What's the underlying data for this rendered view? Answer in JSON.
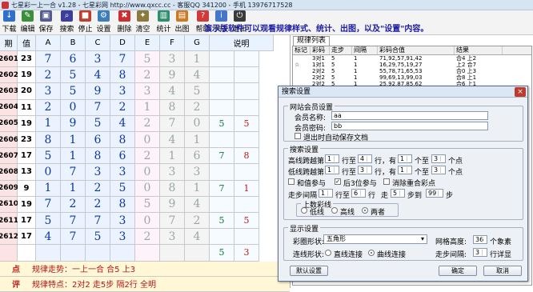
{
  "window": {
    "title": "七星彩一上一合 v1.28 - 七星彩网 http://www.qxcc.cc - 客服QQ 341200 - 手机 13976717528"
  },
  "toolbar": {
    "buttons": [
      {
        "label": "下载",
        "icon": "download-icon",
        "color": "#2e6fcf"
      },
      {
        "label": "编辑",
        "icon": "edit-icon",
        "color": "#3b8f3b"
      },
      {
        "label": "保存",
        "icon": "save-icon",
        "color": "#555b8f"
      },
      {
        "label": "搜索",
        "icon": "search-icon",
        "color": "#3d3d9b"
      },
      {
        "label": "停止",
        "icon": "stop-icon",
        "color": "#c23d2a"
      },
      {
        "label": "设置",
        "icon": "settings-icon",
        "color": "#3c7dbc"
      },
      {
        "label": "删除",
        "icon": "delete-icon",
        "color": "#cc2f2f"
      },
      {
        "label": "清空",
        "icon": "clear-icon",
        "color": "#8c7a3c"
      },
      {
        "label": "统计",
        "icon": "stats-icon",
        "color": "#2e8c6f"
      },
      {
        "label": "出图",
        "icon": "chart-icon",
        "color": "#cc7a22"
      },
      {
        "label": "帮助",
        "icon": "help-icon",
        "color": "#d23a3a"
      },
      {
        "label": "关于",
        "icon": "about-icon",
        "color": "#4477cc"
      },
      {
        "label": "退出",
        "icon": "exit-icon",
        "color": "#3a3a3a"
      }
    ],
    "promo": "演示版软件可以观看规律样式、统计、出图，以及\"设置\"内容。"
  },
  "grid": {
    "headers": [
      "期",
      "值",
      "A",
      "B",
      "C",
      "D",
      "E",
      "F",
      "G",
      "说明"
    ],
    "rows": [
      {
        "period": "2601",
        "value": "23",
        "digits": [
          "7",
          "6",
          "3",
          "7",
          "5",
          "3",
          "1"
        ],
        "note1": "",
        "note2": ""
      },
      {
        "period": "2602",
        "value": "19",
        "digits": [
          "2",
          "5",
          "4",
          "8",
          "2",
          "9",
          "4"
        ],
        "note1": "",
        "note2": ""
      },
      {
        "period": "2603",
        "value": "20",
        "digits": [
          "3",
          "5",
          "9",
          "3",
          "3",
          "4",
          "5"
        ],
        "note1": "",
        "note2": ""
      },
      {
        "period": "2604",
        "value": "11",
        "digits": [
          "2",
          "0",
          "7",
          "2",
          "1",
          "8",
          "2"
        ],
        "note1": "",
        "note2": ""
      },
      {
        "period": "2605",
        "value": "19",
        "digits": [
          "1",
          "9",
          "5",
          "4",
          "2",
          "7",
          "0"
        ],
        "note1": "5",
        "note2": "5"
      },
      {
        "period": "2606",
        "value": "23",
        "digits": [
          "8",
          "1",
          "6",
          "8",
          "0",
          "4",
          "1"
        ],
        "note1": "",
        "note2": ""
      },
      {
        "period": "2607",
        "value": "17",
        "digits": [
          "5",
          "1",
          "8",
          "6",
          "2",
          "1",
          "6"
        ],
        "note1": "7",
        "note2": "8"
      },
      {
        "period": "2608",
        "value": "13",
        "digits": [
          "0",
          "7",
          "3",
          "3",
          "0",
          "3",
          "3"
        ],
        "note1": "",
        "note2": ""
      },
      {
        "period": "2609",
        "value": "9",
        "digits": [
          "1",
          "1",
          "2",
          "5",
          "0",
          "8",
          "1"
        ],
        "note1": "7",
        "note2": "1"
      },
      {
        "period": "2610",
        "value": "19",
        "digits": [
          "7",
          "2",
          "2",
          "8",
          "5",
          "9",
          "4"
        ],
        "note1": "",
        "note2": ""
      },
      {
        "period": "2611",
        "value": "17",
        "digits": [
          "5",
          "7",
          "7",
          "3",
          "0",
          "7",
          "2"
        ],
        "note1": "5",
        "note2": "5"
      },
      {
        "period": "2612",
        "value": "17",
        "digits": [
          "4",
          "7",
          "5",
          "3",
          "2",
          "3",
          "4"
        ],
        "note1": "",
        "note2": ""
      },
      {
        "period": "",
        "value": "",
        "digits": [
          "",
          "",
          "",
          "",
          "",
          "",
          ""
        ],
        "note1": "5",
        "note2": "3"
      }
    ],
    "footer": [
      {
        "key": "点",
        "text": "规律走势：一上一合 合5 上3"
      },
      {
        "key": "评",
        "text": "规律特点：2对2 走5步 隔2行 全明"
      }
    ]
  },
  "results": {
    "tab": "规律列表",
    "columns": [
      "标记",
      "彩码",
      "走步",
      "间隔",
      "彩码合值",
      "结果"
    ],
    "rows": [
      {
        "mark": "",
        "code": "3对1",
        "step": "5",
        "gap": "1",
        "sum": "71,92,57,91,42",
        "result": "合4 上2"
      },
      {
        "mark": "☆",
        "code": "1对1",
        "step": "5",
        "gap": "1",
        "sum": "16,29,75,19,27",
        "result": "上2 合7"
      },
      {
        "mark": "",
        "code": "2对2",
        "step": "5",
        "gap": "1",
        "sum": "55,78,71,65,53",
        "result": "合0 上3"
      },
      {
        "mark": "",
        "code": "2对2",
        "step": "5",
        "gap": "1",
        "sum": "99,69,13,99,03",
        "result": "合8 上1"
      },
      {
        "mark": "",
        "code": "2对2",
        "step": "5",
        "gap": "1",
        "sum": "25,92,87,85,62",
        "result": "合6 上1"
      }
    ]
  },
  "dialog": {
    "title": "搜索设置",
    "close": "×",
    "member": {
      "group": "网站会员设置",
      "name_label": "会员名称:",
      "name_value": "aa",
      "pwd_label": "会员密码:",
      "pwd_value": "bb",
      "autosave": "退出时自动保存文档"
    },
    "search": {
      "group": "搜索设置",
      "high_label": "高线跨越第",
      "high_v1": "1",
      "high_t1": "行至",
      "high_v2": "4",
      "high_t2": "行，有",
      "high_v3": "1",
      "high_t3": "个至",
      "high_v4": "3",
      "high_t4": "个点",
      "low_label": "低线跨越第",
      "low_v1": "1",
      "low_t1": "行至",
      "low_v2": "3",
      "low_t2": "行，有",
      "low_v3": "1",
      "low_t3": "个至",
      "low_v4": "3",
      "low_t4": "个点",
      "opt1": "和值参与",
      "opt2": "后3位参与",
      "opt3": "消除重合彩点",
      "step_label": "走步间隔",
      "step_v1": "1",
      "step_t1": "行至",
      "step_v2": "6",
      "step_t2": "行",
      "step_t3": "走",
      "step_v3": "5",
      "step_t4": "步到",
      "step_v4": "99",
      "step_t5": "步",
      "line_group": "上数彩线",
      "line_low": "低线",
      "line_high": "高线",
      "line_both": "两者"
    },
    "display": {
      "group": "显示设置",
      "shape_label": "彩圈形状:",
      "shape_value": "五角形",
      "height_label": "网格高度:",
      "height_value": "36",
      "height_unit": "个象素",
      "conn_label": "连线形状:",
      "conn_opt1": "直线连接",
      "conn_opt2": "曲线连接",
      "gap_label": "走步间隔:",
      "gap_value": "3",
      "gap_unit": "行详显"
    },
    "btn_default": "默认设置",
    "btn_ok": "确定",
    "btn_cancel": "取消"
  }
}
